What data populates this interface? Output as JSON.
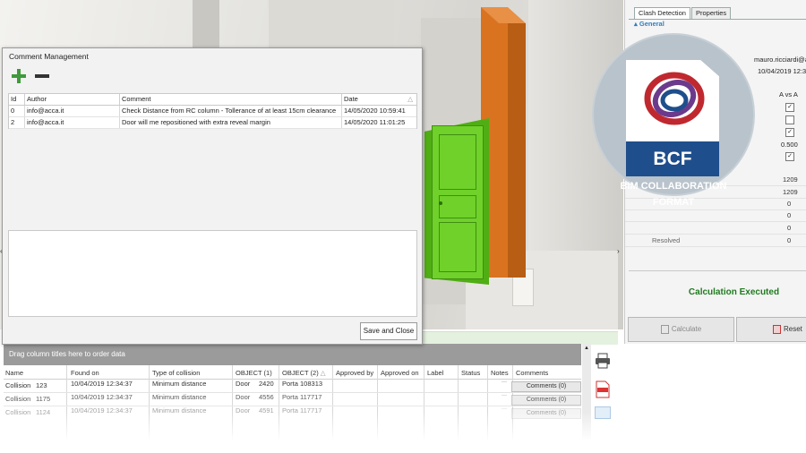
{
  "dialog": {
    "title": "Comment Management",
    "columns": [
      "Id",
      "Author",
      "Comment",
      "Date"
    ],
    "rows": [
      {
        "id": "0",
        "author": "info@acca.it",
        "comment": "Check Distance from RC column - Tollerance of at least 15cm clearance",
        "date": "14/05/2020 10:59:41"
      },
      {
        "id": "2",
        "author": "info@acca.it",
        "comment": "Door will me repositioned with extra reveal margin",
        "date": "14/05/2020 11:01:25"
      }
    ],
    "save_close_label": "Save and Close"
  },
  "right_panel": {
    "tabs": [
      "Clash Detection",
      "Properties"
    ],
    "section": "General",
    "user": "mauro.ricciardi@a",
    "date": "10/04/2019 12:3",
    "column_header": "A vs A",
    "values": [
      "0.500",
      "1209",
      "1209",
      "0",
      "0",
      "0"
    ],
    "resolved_label": "Resolved",
    "resolved_value": "0",
    "status": "Calculation Executed",
    "calculate_label": "Calculate",
    "reset_label": "Reset"
  },
  "grid": {
    "group_hint": "Drag column titles here to order data",
    "columns": [
      "Name",
      "Found on",
      "Type of collision",
      "OBJECT (1)",
      "OBJECT (2)",
      "Approved by",
      "Approved on",
      "Label",
      "Status",
      "Notes",
      "Comments"
    ],
    "rows": [
      {
        "name": "Collision",
        "num": "123",
        "found": "10/04/2019 12:34:37",
        "type": "Minimum distance",
        "obj1": "Door",
        "obj1_id": "2420",
        "obj2": "Porta 108313",
        "comments": "Comments (0)"
      },
      {
        "name": "Collision",
        "num": "1175",
        "found": "10/04/2019 12:34:37",
        "type": "Minimum distance",
        "obj1": "Door",
        "obj1_id": "4556",
        "obj2": "Porta 117717",
        "comments": "Comments (0)"
      },
      {
        "name": "Collision",
        "num": "1124",
        "found": "10/04/2019 12:34:37",
        "type": "Minimum distance",
        "obj1": "Door",
        "obj1_id": "4591",
        "obj2": "Porta 117717",
        "comments": "Comments (0)"
      }
    ]
  },
  "badge": {
    "logo_text": "BCF",
    "line1": "BIM  COLLABORATION",
    "line2": "FORMAT"
  },
  "colors": {
    "status_green": "#1f7a1f",
    "door_green": "#66cc22",
    "column_orange": "#d9731f",
    "badge_blue": "#1f4e8c"
  }
}
